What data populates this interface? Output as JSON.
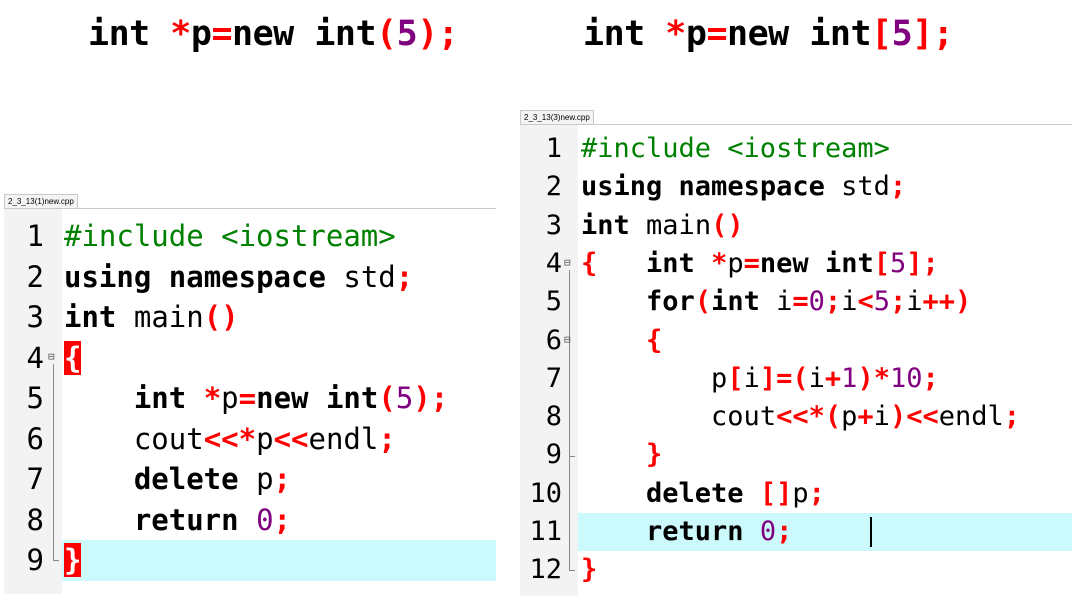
{
  "headings": {
    "left": "int *p=new int(5);",
    "right": "int *p=new int[5];"
  },
  "left_editor": {
    "tab_title": "2_3_13(1)new.cpp",
    "line_numbers": [
      "1",
      "2",
      "3",
      "4",
      "5",
      "6",
      "7",
      "8",
      "9"
    ],
    "lines": [
      "#include <iostream>",
      "using namespace std;",
      "int main()",
      "{",
      "    int *p=new int(5);",
      "    cout<<*p<<endl;",
      "    delete p;",
      "    return 0;",
      "}"
    ],
    "highlighted_line": 9
  },
  "right_editor": {
    "tab_title": "2_3_13(3)new.cpp",
    "line_numbers": [
      "1",
      "2",
      "3",
      "4",
      "5",
      "6",
      "7",
      "8",
      "9",
      "10",
      "11",
      "12"
    ],
    "lines": [
      "#include <iostream>",
      "using namespace std;",
      "int main()",
      "{   int *p=new int[5];",
      "    for(int i=0;i<5;i++)",
      "    {",
      "        p[i]=(i+1)*10;",
      "        cout<<*(p+i)<<endl;",
      "    }",
      "    delete []p;",
      "    return 0;",
      "}"
    ],
    "highlighted_line": 11
  },
  "colors": {
    "keyword": "#000000",
    "operator": "#ff0000",
    "number": "#800080",
    "preprocessor": "#008000",
    "current_line": "#ccf9fb",
    "brace_match": "#ff0000"
  },
  "icons": [
    "fold-minus-icon",
    "text-caret"
  ]
}
